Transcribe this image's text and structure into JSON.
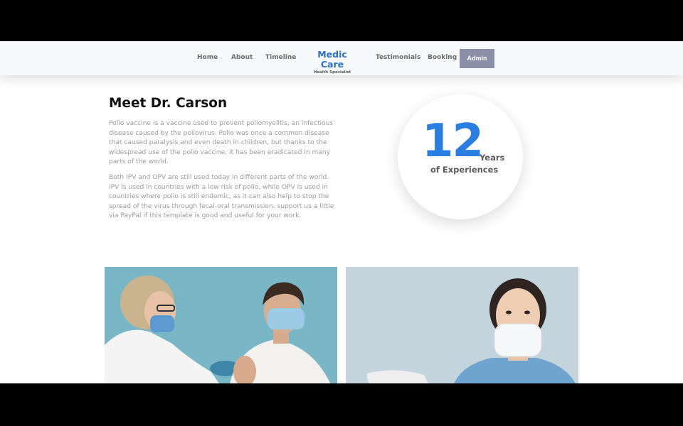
{
  "navbar": {
    "links": [
      "Home",
      "About",
      "Timeline",
      "Testimonials",
      "Booking"
    ],
    "brand": {
      "title": "Medic Care",
      "subtitle": "Health Specialist"
    },
    "admin_label": "Admin"
  },
  "about": {
    "heading": "Meet Dr. Carson",
    "paragraphs": [
      "Polio vaccine is a vaccine used to prevent poliomyelitis, an infectious disease caused by the poliovirus. Polio was once a common disease that caused paralysis and even death in children, but thanks to the widespread use of the polio vaccine, it has been eradicated in many parts of the world.",
      "Both IPV and OPV are still used today in different parts of the world. IPV is used in countries with a low risk of polio, while OPV is used in countries where polio is still endemic, as it can also help to stop the spread of the virus through fecal-oral transmission. support us a little via PayPal if this template is good and useful for your work."
    ]
  },
  "experience": {
    "number": "12",
    "unit": "Years",
    "label": "of Experiences"
  },
  "photos": [
    {
      "icon": "vaccination-photo",
      "bg": "#7ab8c8"
    },
    {
      "icon": "nurse-photo",
      "bg": "#c3d4dc"
    }
  ],
  "colors": {
    "brand": "#2a6fc9",
    "accent": "#2a7de1",
    "admin_button": "#8c8fa8",
    "navbar_bg": "#f8f9fa"
  }
}
